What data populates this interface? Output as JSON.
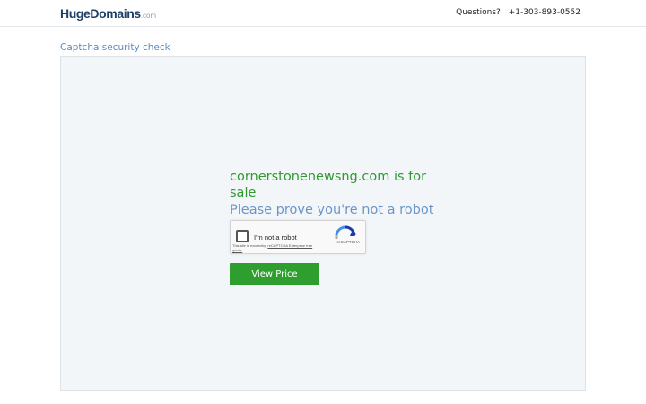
{
  "header": {
    "logo_huge": "Huge",
    "logo_domains": "Domains",
    "logo_com": ".com",
    "questions_label": "Questions?",
    "phone": "+1-303-893-0552"
  },
  "main": {
    "check_label": "Captcha security check",
    "domain_title": "cornerstonenewsng.com is for sale",
    "prove_text": "Please prove you're not a robot",
    "recaptcha": {
      "checkbox_label": "I'm not a robot",
      "brand": "reCAPTCHA",
      "note_prefix": "This site is exceeding ",
      "note_link": "reCAPTCHA Enterprise free quota."
    },
    "view_price_label": "View Price"
  },
  "colors": {
    "accent_green": "#2e9e2f",
    "link_blue": "#5b8bc1",
    "panel_bg": "#f3f6f9"
  }
}
